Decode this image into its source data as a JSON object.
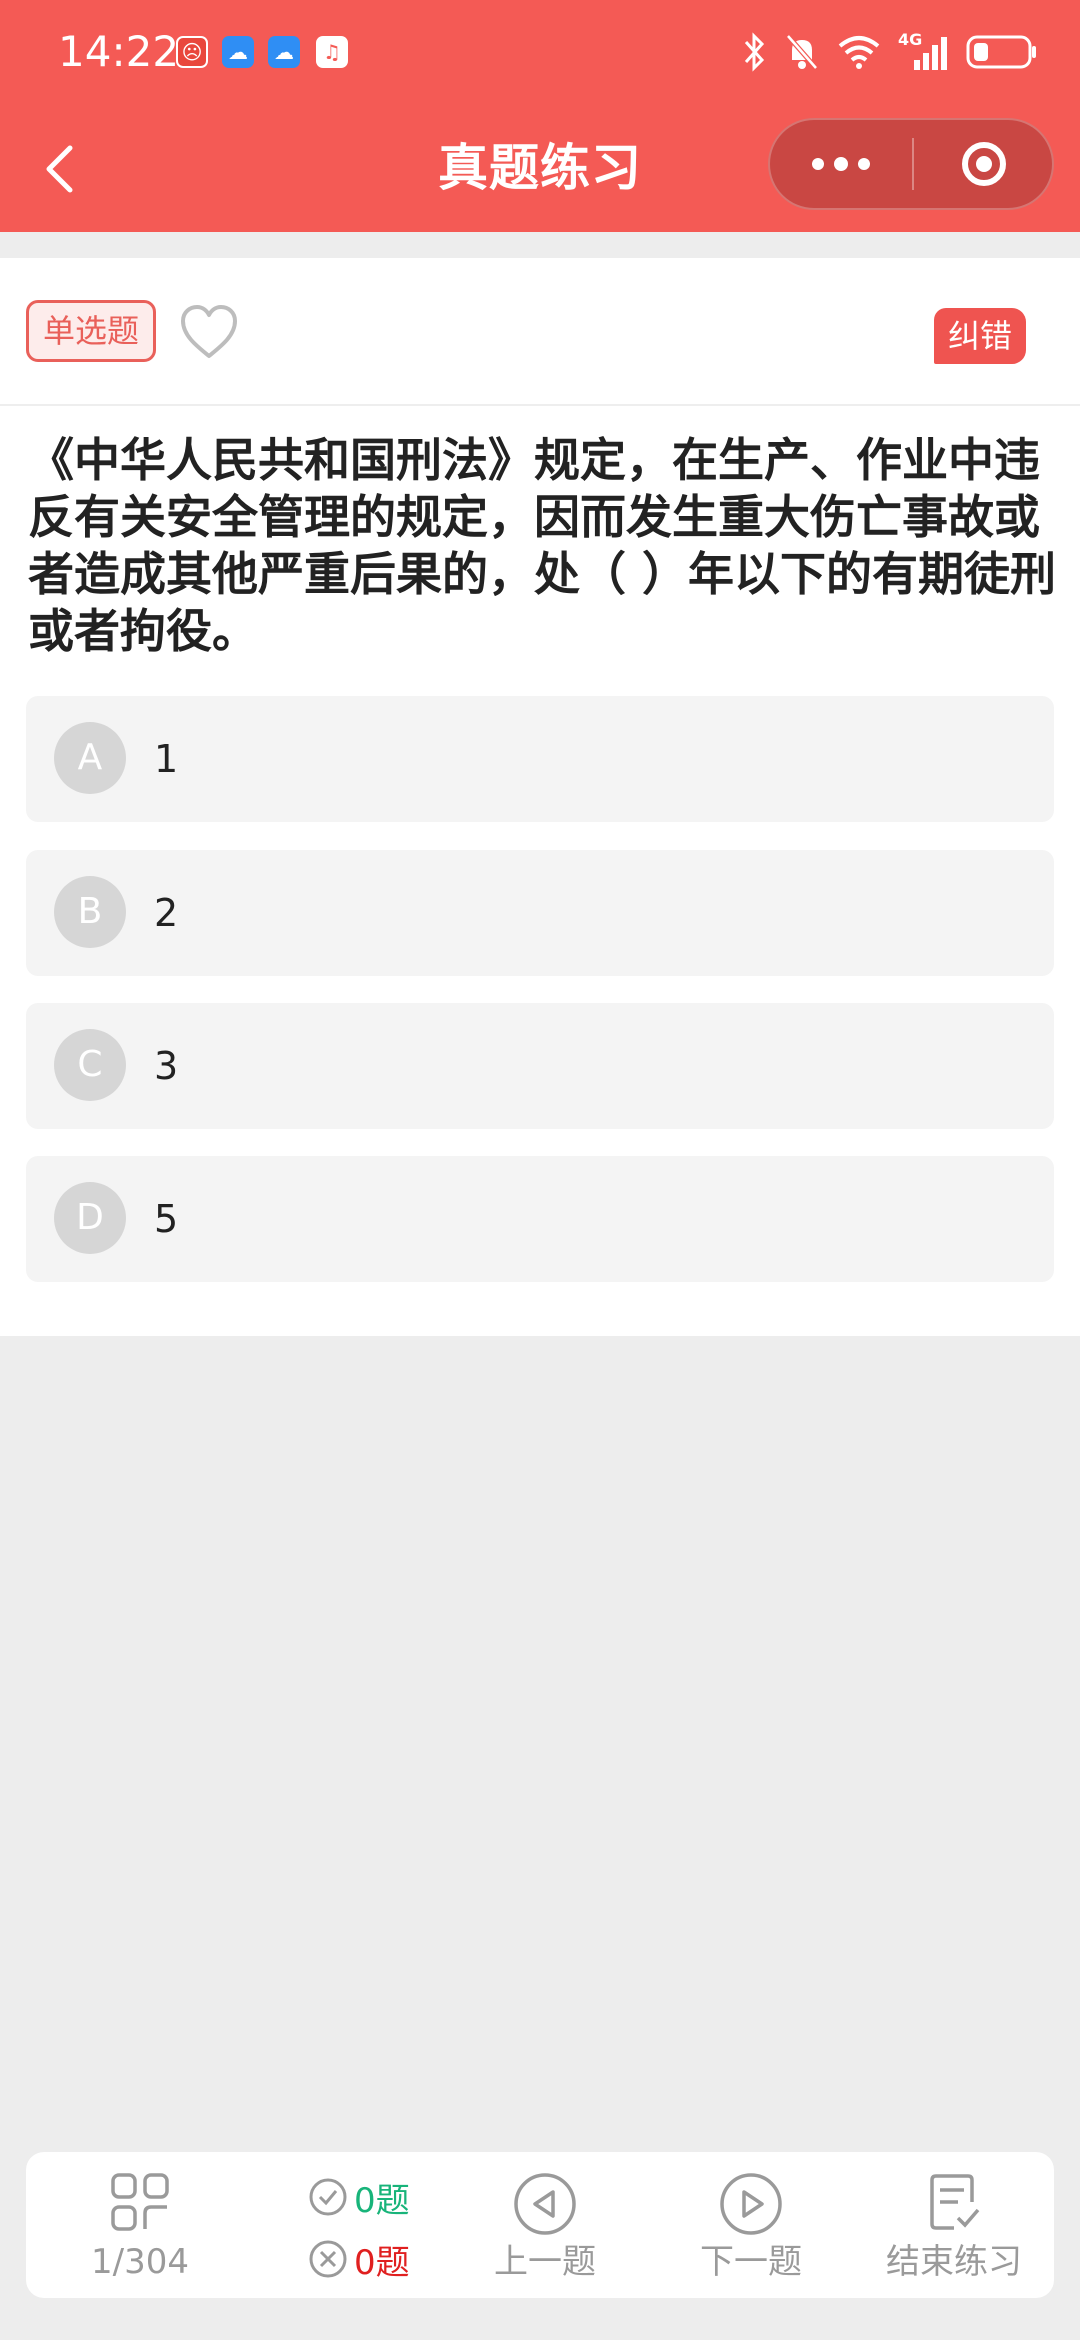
{
  "status_bar": {
    "time": "14:22",
    "network": "4G"
  },
  "header": {
    "title": "真题练习"
  },
  "question": {
    "type_label": "单选题",
    "correct_label": "纠错",
    "text": "《中华人民共和国刑法》规定，在生产、作业中违反有关安全管理的规定，因而发生重大伤亡事故或者造成其他严重后果的，处（ ）年以下的有期徒刑或者拘役。",
    "options": [
      {
        "letter": "A",
        "value": "1"
      },
      {
        "letter": "B",
        "value": "2"
      },
      {
        "letter": "C",
        "value": "3"
      },
      {
        "letter": "D",
        "value": "5"
      }
    ]
  },
  "bottom_nav": {
    "progress": "1/304",
    "correct_count": "0题",
    "wrong_count": "0题",
    "prev_label": "上一题",
    "next_label": "下一题",
    "end_label": "结束练习"
  },
  "colors": {
    "brand": "#f45a55",
    "correct": "#18b47a",
    "wrong": "#e02020"
  }
}
